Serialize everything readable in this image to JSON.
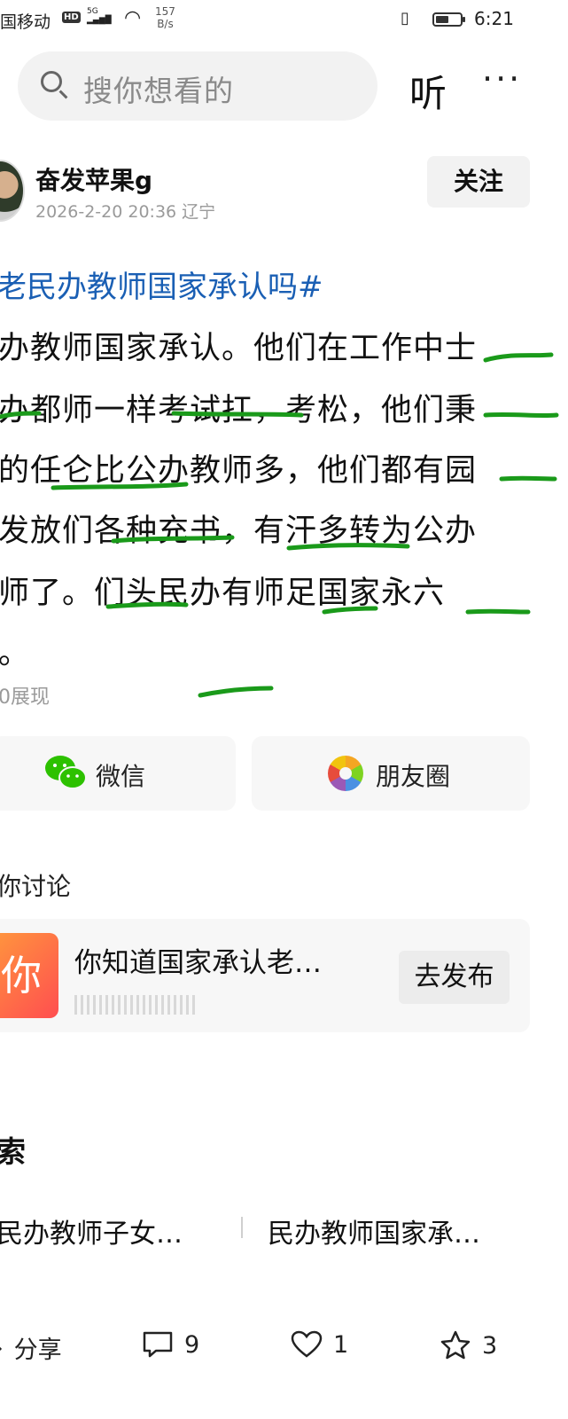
{
  "status_bar": {
    "carrier": "国移动",
    "hd": "HD",
    "network": "5G",
    "net_speed_value": "157",
    "net_speed_unit": "B/s",
    "time": "6:21",
    "battery_level": 0.55
  },
  "search": {
    "placeholder": "搜你想看的",
    "listen_label": "听",
    "more_label": "···"
  },
  "post": {
    "author": "奋发苹果g",
    "meta": "2026-2-20 20:36 辽宁",
    "follow_label": "关注",
    "topic": "老民办教师国家承认吗#",
    "lines": [
      "办教师国家承认。他们在工作中士",
      "办都师一样考试扛，考松，他们秉",
      "的任仑比公办教师多，他们都有园",
      "发放们各种充书，有汗多转为公办",
      "师了。们头民办有师足国家永六",
      "。"
    ],
    "views": "0展现"
  },
  "share": {
    "wechat_label": "微信",
    "moments_label": "朋友圈"
  },
  "discussion": {
    "title": "你讨论",
    "badge": "你",
    "text": "你知道国家承认老…",
    "post_button": "去发布"
  },
  "related": {
    "title": "索",
    "items": [
      "民办教师子女…",
      "民办教师国家承…"
    ]
  },
  "bottom_bar": {
    "share_label": "分享",
    "comments": "9",
    "likes": "1",
    "favorites": "3"
  },
  "colors": {
    "topic_link": "#1a5fb4",
    "annotation_marks": "#1a9a1a",
    "muted_text": "#9a9a9a",
    "card_bg": "#f7f7f7"
  }
}
